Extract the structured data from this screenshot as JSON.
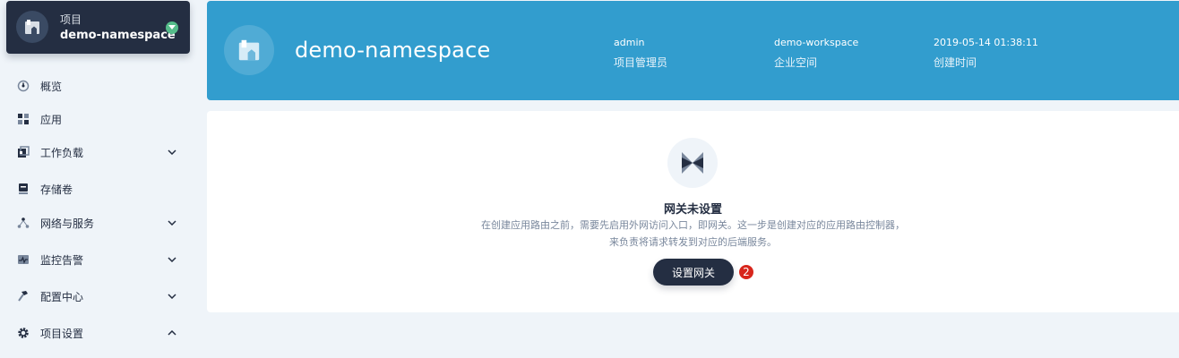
{
  "project_card": {
    "label": "项目",
    "name": "demo-namespace",
    "avatar_icon": "project-icon",
    "toggle_icon": "caret-down-icon",
    "toggle_color": "#55bc8a"
  },
  "nav": {
    "items": [
      {
        "label": "概览",
        "icon": "dashboard-icon",
        "expandable": false
      },
      {
        "label": "应用",
        "icon": "appcenter-icon",
        "expandable": false
      },
      {
        "label": "工作负载",
        "icon": "workload-icon",
        "expandable": true,
        "state": "collapsed"
      },
      {
        "label": "存储卷",
        "icon": "storage-icon",
        "expandable": false
      },
      {
        "label": "网络与服务",
        "icon": "network-icon",
        "expandable": true,
        "state": "collapsed"
      },
      {
        "label": "监控告警",
        "icon": "monitor-icon",
        "expandable": true,
        "state": "collapsed"
      },
      {
        "label": "配置中心",
        "icon": "hammer-icon",
        "expandable": true,
        "state": "collapsed"
      },
      {
        "label": "项目设置",
        "icon": "gear-icon",
        "expandable": true,
        "state": "expanded"
      }
    ]
  },
  "banner": {
    "title": "demo-namespace",
    "icon": "project-icon",
    "background": "#329dce",
    "meta": [
      {
        "value": "admin",
        "label": "项目管理员"
      },
      {
        "value": "demo-workspace",
        "label": "企业空间"
      },
      {
        "value": "2019-05-14 01:38:11",
        "label": "创建时间"
      }
    ]
  },
  "empty_state": {
    "icon": "gateway-icon",
    "title": "网关未设置",
    "desc_line1": "在创建应用路由之前，需要先启用外网访问入口，即网关。这一步是创建对应的应用路由控制器，",
    "desc_line2": "来负责将请求转发到对应的后端服务。",
    "button_label": "设置网关",
    "step_badge": "2",
    "badge_color": "#d8261c"
  }
}
